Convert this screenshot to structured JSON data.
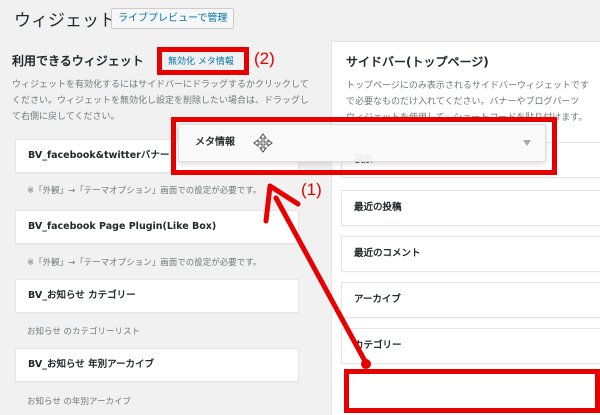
{
  "header": {
    "title": "ウィジェット",
    "live_preview_button": "ライブプレビューで管理"
  },
  "available": {
    "title": "利用できるウィジェット",
    "disable_link": "無効化 メタ情報",
    "description": "ウィジェットを有効化するにはサイドバーにドラッグするかクリックしてください。ウィジェットを無効化し設定を削除したい場合は、ドラッグして右側に戻してください。",
    "widgets": [
      {
        "label": "BV_facebook&twitterバナー",
        "desc": "※「外観」→「テーマオプション」画面での設定が必要です。"
      },
      {
        "label": "BV_facebook Page Plugin(Like Box)",
        "desc": "※「外観」→「テーマオプション」画面での設定が必要です。"
      },
      {
        "label": "BV_お知らせ カテゴリー",
        "desc": "お知らせ のカテゴリーリスト"
      },
      {
        "label": "BV_お知らせ 年別アーカイブ",
        "desc": "お知らせ の年別アーカイブ"
      }
    ]
  },
  "sidebar": {
    "title": "サイドバー(トップページ)",
    "description_line1": "トップページにのみ表示されるサイドバーウィジェットです",
    "description_line2": "で必要なものだけ入れてください。バナーやブログパーツ",
    "description_line3": "ウィジェットを使用して、ショートコードを貼り付けます。",
    "widgets": [
      "検索",
      "最近の投稿",
      "最近のコメント",
      "アーカイブ",
      "カテゴリー"
    ]
  },
  "dragging_widget": {
    "label": "メタ情報"
  },
  "annotations": {
    "label1": "(1)",
    "label2": "(2)",
    "color": "#e60000"
  }
}
